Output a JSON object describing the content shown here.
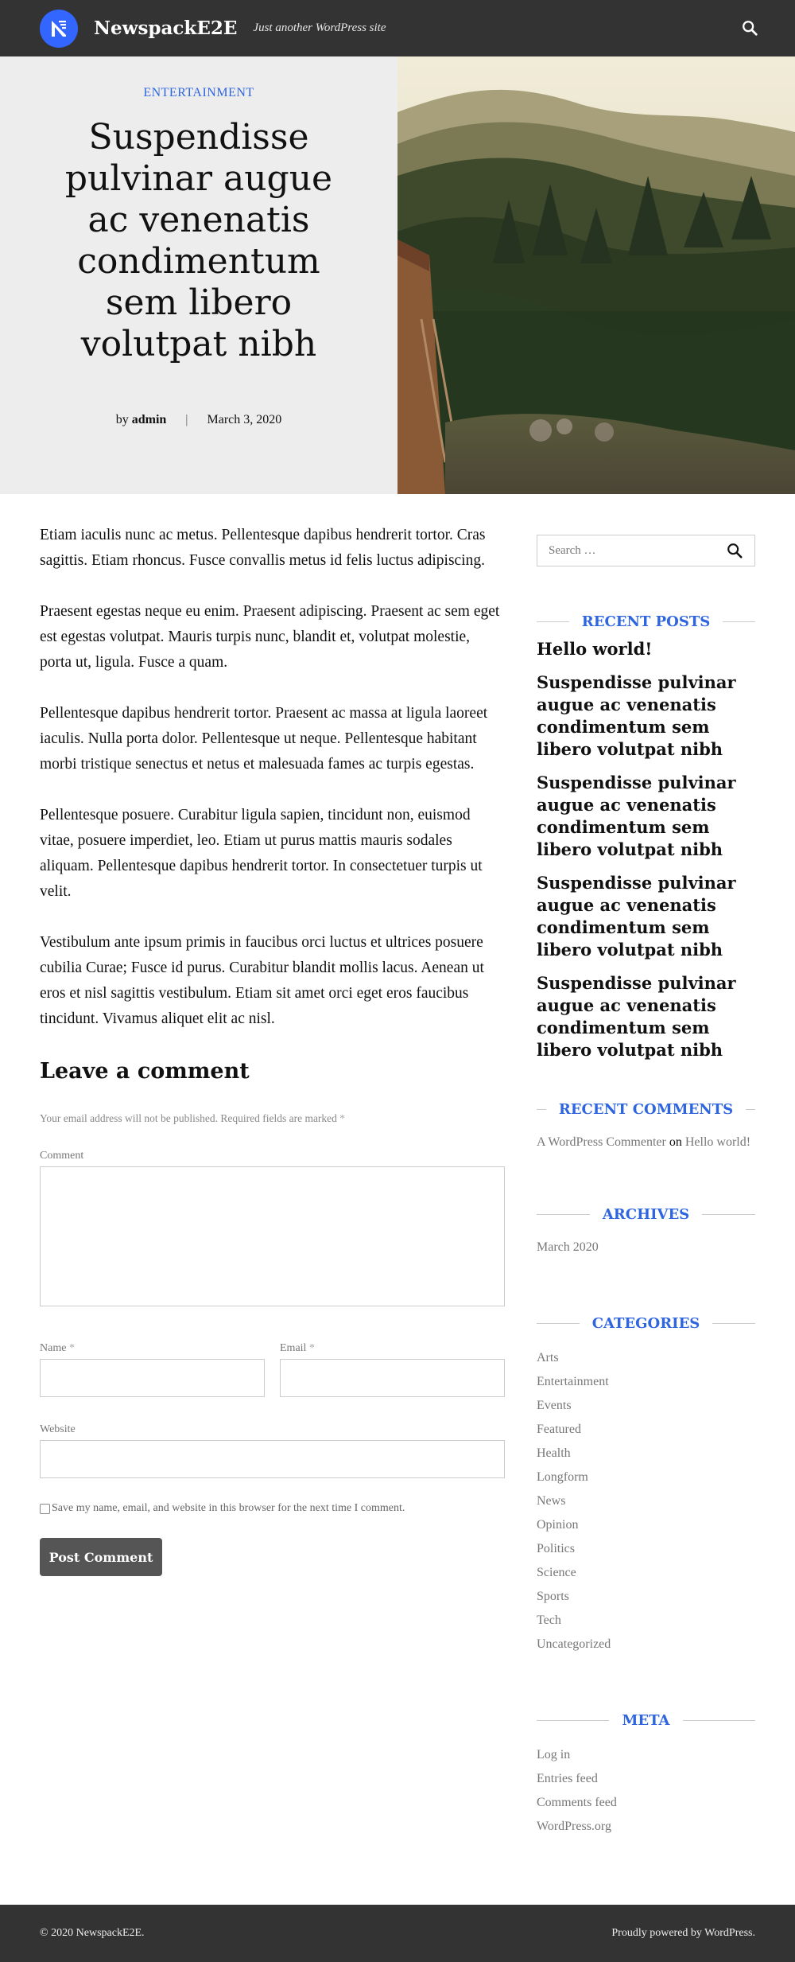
{
  "header": {
    "site_title": "NewspackE2E",
    "tagline": "Just another WordPress site",
    "logo_icon": "newspack-logo-icon",
    "search_icon": "search-icon",
    "accent": "#3366ff",
    "background": "#333333"
  },
  "hero": {
    "category": "ENTERTAINMENT",
    "title": "Suspendisse pulvinar augue ac venenatis condimentum sem libero volutpat nibh",
    "by": "by",
    "author": "admin",
    "separator": "|",
    "date": "March 3, 2020",
    "category_color": "#2f66e0"
  },
  "article": {
    "paragraphs": [
      "Etiam iaculis nunc ac metus. Pellentesque dapibus hendrerit tortor. Cras sagittis. Etiam rhoncus. Fusce convallis metus id felis luctus adipiscing.",
      "Praesent egestas neque eu enim. Praesent adipiscing. Praesent ac sem eget est egestas volutpat. Mauris turpis nunc, blandit et, volutpat molestie, porta ut, ligula. Fusce a quam.",
      "Pellentesque dapibus hendrerit tortor. Praesent ac massa at ligula laoreet iaculis. Nulla porta dolor. Pellentesque ut neque. Pellentesque habitant morbi tristique senectus et netus et malesuada fames ac turpis egestas.",
      "Pellentesque posuere. Curabitur ligula sapien, tincidunt non, euismod vitae, posuere imperdiet, leo. Etiam ut purus mattis mauris sodales aliquam. Pellentesque dapibus hendrerit tortor. In consectetuer turpis ut velit.",
      "Vestibulum ante ipsum primis in faucibus orci luctus et ultrices posuere cubilia Curae; Fusce id purus. Curabitur blandit mollis lacus. Aenean ut eros et nisl sagittis vestibulum. Etiam sit amet orci eget eros faucibus tincidunt. Vivamus aliquet elit ac nisl."
    ]
  },
  "comment_form": {
    "title": "Leave a comment",
    "notes": "Your email address will not be published. Required fields are marked",
    "required_mark": "*",
    "comment_label": "Comment",
    "name_label": "Name",
    "email_label": "Email",
    "website_label": "Website",
    "comment_value": "",
    "name_value": "",
    "email_value": "",
    "website_value": "",
    "save_label": "Save my name, email, and website in this browser for the next time I comment.",
    "save_checked": false,
    "submit_label": "Post Comment"
  },
  "sidebar": {
    "search_placeholder": "Search …",
    "recent_posts": {
      "title": "RECENT POSTS",
      "items": [
        "Hello world!",
        "Suspendisse pulvinar augue ac venenatis condimentum sem libero volutpat nibh",
        "Suspendisse pulvinar augue ac venenatis condimentum sem libero volutpat nibh",
        "Suspendisse pulvinar augue ac venenatis condimentum sem libero volutpat nibh",
        "Suspendisse pulvinar augue ac venenatis condimentum sem libero volutpat nibh"
      ]
    },
    "recent_comments": {
      "title": "RECENT COMMENTS",
      "author": "A WordPress Commenter",
      "on": "on",
      "post": "Hello world!"
    },
    "archives": {
      "title": "ARCHIVES",
      "items": [
        "March 2020"
      ]
    },
    "categories": {
      "title": "CATEGORIES",
      "items": [
        "Arts",
        "Entertainment",
        "Events",
        "Featured",
        "Health",
        "Longform",
        "News",
        "Opinion",
        "Politics",
        "Science",
        "Sports",
        "Tech",
        "Uncategorized"
      ]
    },
    "meta": {
      "title": "META",
      "items": [
        "Log in",
        "Entries feed",
        "Comments feed",
        "WordPress.org"
      ]
    }
  },
  "footer": {
    "copyright": "© 2020 NewspackE2E.",
    "powered": "Proudly powered by WordPress."
  }
}
